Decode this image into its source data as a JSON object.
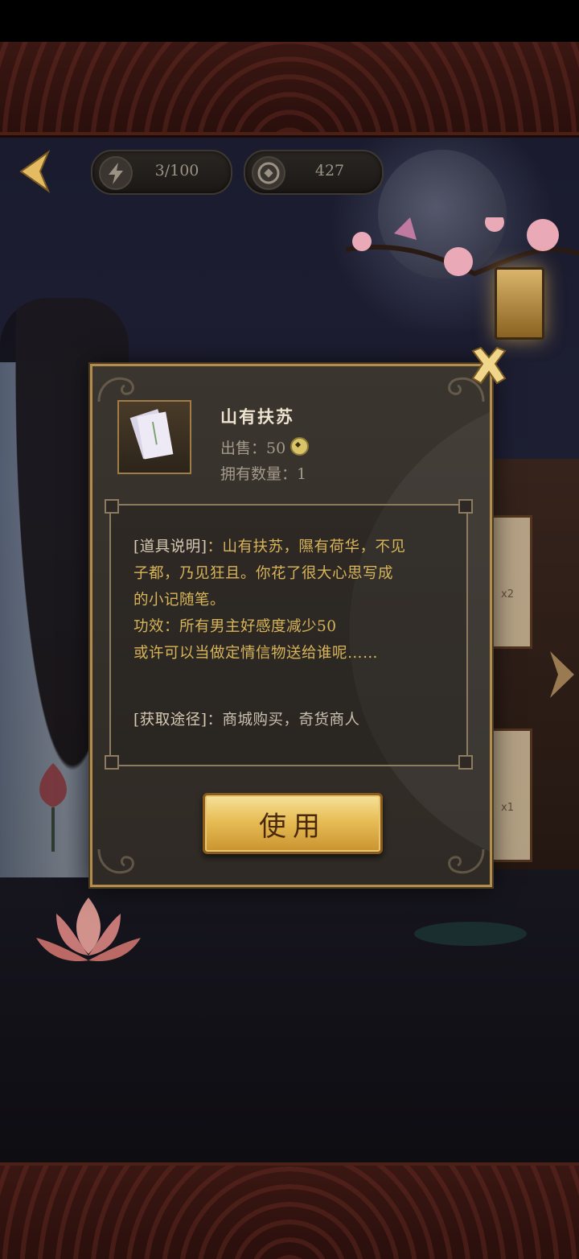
{
  "hud": {
    "energy_icon": "lightning-icon",
    "energy_value": "3/100",
    "coin_icon": "coin-icon",
    "coin_value": "427"
  },
  "side_cards": [
    {
      "count": "x2"
    },
    {
      "count": "x1"
    }
  ],
  "item": {
    "name": "山有扶苏",
    "sell_label": "出售：",
    "sell_price": "50",
    "own_label": "拥有数量：",
    "own_count": "1"
  },
  "description": {
    "label": "[道具说明]",
    "line1": "：山有扶苏，隰有荷华，不见",
    "line2": "子都，乃见狂且。你花了很大心思写成",
    "line3": "的小记随笔。",
    "line4": "功效：所有男主好感度减少50",
    "line5": "或许可以当做定情信物送给谁呢……",
    "obtain_label": "[获取途径]",
    "obtain_text": "：商城购买，奇货商人"
  },
  "buttons": {
    "use_label": "使用"
  },
  "colors": {
    "accent_gold": "#d8b45a",
    "frame_gold": "#b38d4e",
    "button_gold": "#e7bd56"
  }
}
